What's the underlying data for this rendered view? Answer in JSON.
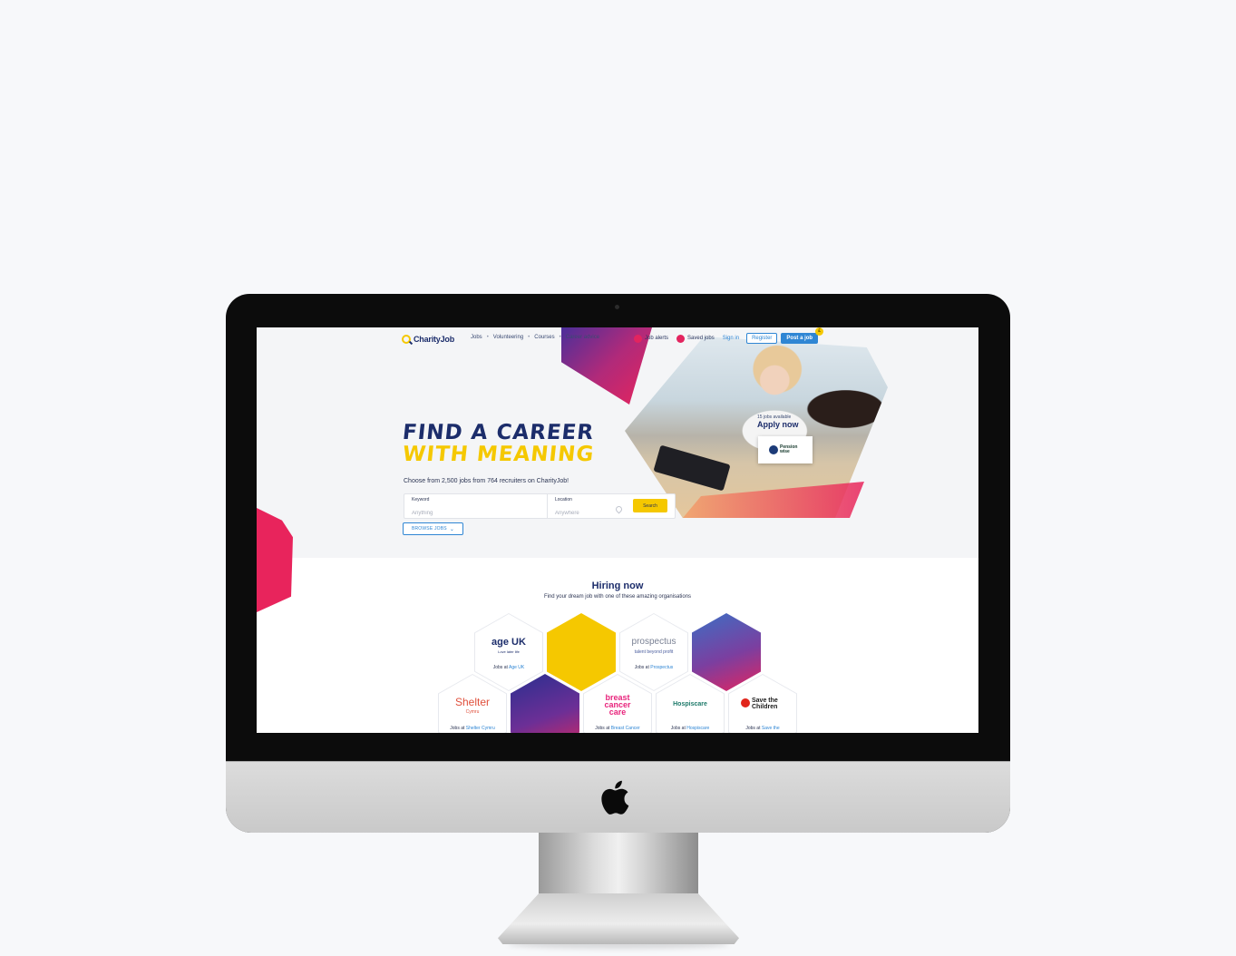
{
  "site": {
    "logo_text": "CharityJob"
  },
  "nav": {
    "links": [
      "Jobs",
      "Volunteering",
      "Courses",
      "Career advice"
    ],
    "job_alerts": "Job alerts",
    "saved_jobs": "Saved jobs",
    "sign_in": "Sign in",
    "register": "Register",
    "post_job": "Post a job",
    "post_job_badge": "£"
  },
  "hero": {
    "headline_line1": "FIND A CAREER",
    "headline_line2": "WITH MEANING",
    "subline": "Choose from 2,500 jobs from 764 recruiters on CharityJob!",
    "apply_label": "15 jobs available",
    "apply_now": "Apply now",
    "featured_employer": "Pension wise"
  },
  "search": {
    "keyword_label": "Keyword",
    "keyword_placeholder": "Anything",
    "location_label": "Location",
    "location_placeholder": "Anywhere",
    "search_button": "Search",
    "browse_button": "BROWSE JOBS"
  },
  "hiring": {
    "title": "Hiring now",
    "subtitle": "Find your dream job with one of these amazing organisations",
    "jobs_at_prefix": "Jobs at",
    "orgs": [
      {
        "logo": "age UK",
        "tagline": "Love later life",
        "name": "Age UK"
      },
      {
        "logo": "prospectus",
        "tagline": "talent beyond profit",
        "name": "Prospectus"
      },
      {
        "logo": "Shelter",
        "tagline": "Cymru",
        "name": "Shelter Cymru"
      },
      {
        "logo": "breast cancer care",
        "tagline": "",
        "name": "Breast Cancer"
      },
      {
        "logo": "Hospiscare",
        "tagline": "",
        "name": "Hospiscare"
      },
      {
        "logo": "Save the Children",
        "tagline": "",
        "name": "Save the"
      }
    ]
  },
  "colors": {
    "navy": "#1c2d6b",
    "yellow": "#f5c800",
    "pink": "#e8245c",
    "blue": "#2f86d4"
  }
}
